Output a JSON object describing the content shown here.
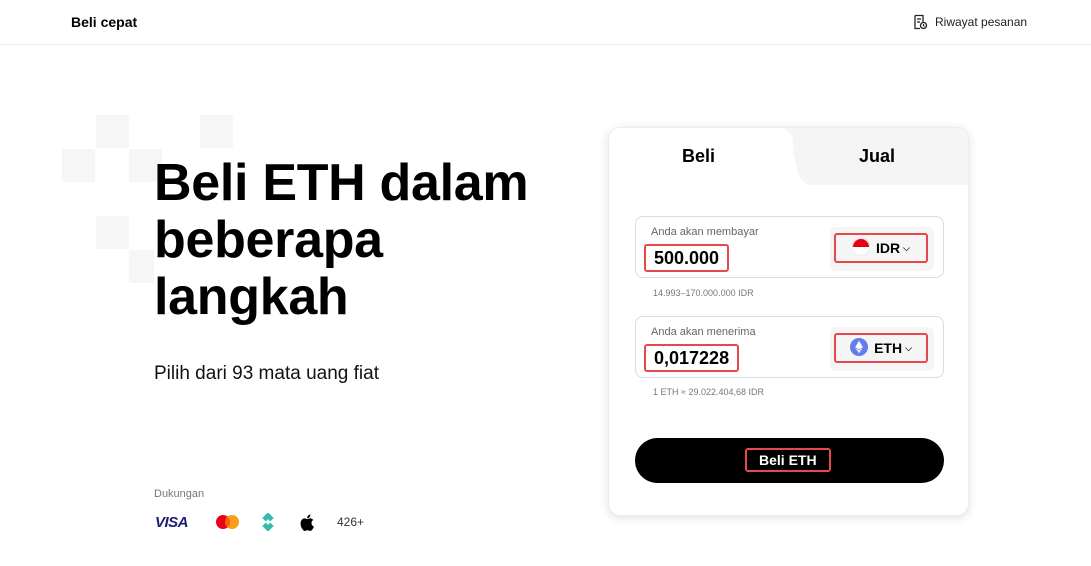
{
  "header": {
    "brand": "Beli cepat",
    "order_history": "Riwayat pesanan"
  },
  "hero": {
    "title": "Beli ETH dalam beberapa langkah",
    "subtitle": "Pilih dari 93 mata uang fiat"
  },
  "support": {
    "label": "Dukungan",
    "methods": [
      "VISA",
      "mastercard-icon",
      "pix-icon",
      "apple-pay-icon"
    ],
    "visa": "VISA",
    "more": "426+"
  },
  "widget": {
    "tabs": {
      "buy": "Beli",
      "sell": "Jual"
    },
    "pay": {
      "label": "Anda akan membayar",
      "value": "500.000",
      "currency": "IDR",
      "range_hint": "14.993–170.000.000 IDR"
    },
    "receive": {
      "label": "Anda akan menerima",
      "value": "0,017228",
      "currency": "ETH",
      "rate_hint": "1 ETH ≈ 29.022.404,68 IDR"
    },
    "submit_label": "Beli ETH"
  },
  "colors": {
    "accent_outline": "#e5484d",
    "button": "#000000",
    "eth": "#627eea",
    "idr_flag_top": "#e70011",
    "mastercard_red": "#eb001b",
    "mastercard_orange": "#f79e1b",
    "pix": "#32bcad",
    "visa": "#1a1f71"
  }
}
